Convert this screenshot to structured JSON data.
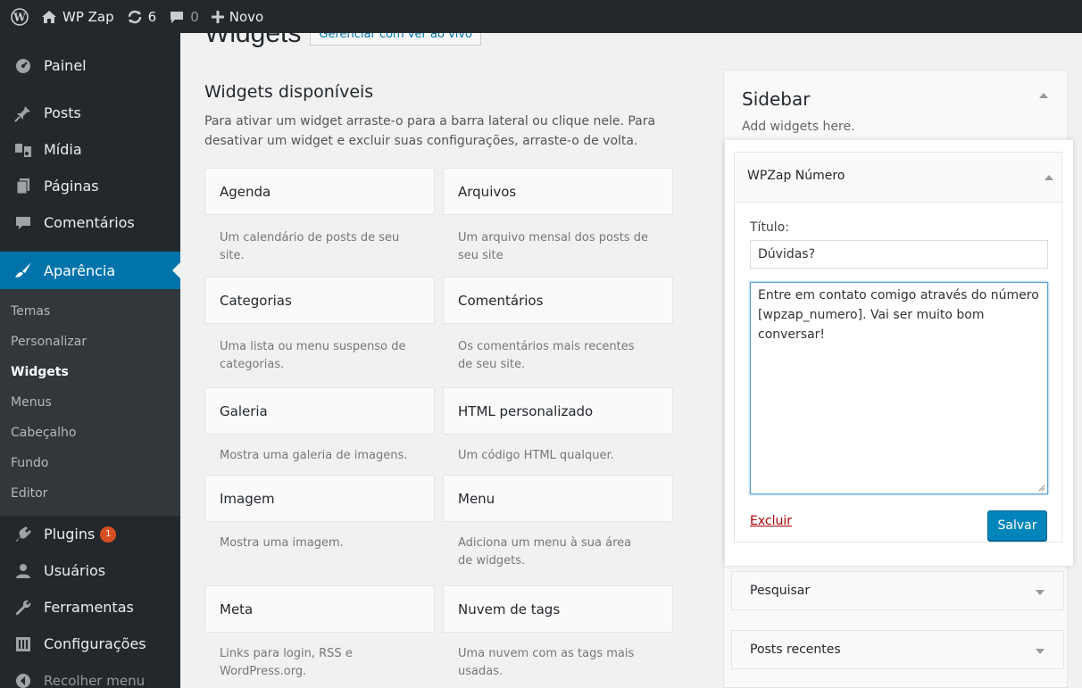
{
  "adminbar": {
    "site_name": "WP Zap",
    "updates_count": "6",
    "comments_count": "0",
    "new_label": "Novo"
  },
  "menu": {
    "items_top": [
      {
        "label": "Painel",
        "icon": "dashboard-icon"
      },
      {
        "label": "Posts",
        "icon": "pin-icon"
      },
      {
        "label": "Mídia",
        "icon": "media-icon"
      },
      {
        "label": "Páginas",
        "icon": "page-icon"
      },
      {
        "label": "Comentários",
        "icon": "comment-icon"
      }
    ],
    "active": {
      "label": "Aparência",
      "icon": "brush-icon"
    },
    "submenu": [
      "Temas",
      "Personalizar",
      "Widgets",
      "Menus",
      "Cabeçalho",
      "Fundo",
      "Editor"
    ],
    "submenu_current": "Widgets",
    "items_bottom": [
      {
        "label": "Plugins",
        "icon": "plugin-icon",
        "badge": "1"
      },
      {
        "label": "Usuários",
        "icon": "users-icon"
      },
      {
        "label": "Ferramentas",
        "icon": "wrench-icon"
      },
      {
        "label": "Configurações",
        "icon": "settings-icon"
      },
      {
        "label": "Recolher menu",
        "icon": "collapse-icon"
      }
    ]
  },
  "page": {
    "title": "Widgets",
    "action_label": "Gerenciar com ver ao vivo"
  },
  "available": {
    "title": "Widgets disponíveis",
    "description": "Para ativar um widget arraste-o para a barra lateral ou clique nele. Para desativar um widget e excluir suas configurações, arraste-o de volta.",
    "widgets": [
      {
        "name": "Agenda",
        "desc": "Um calendário de posts de seu site."
      },
      {
        "name": "Arquivos",
        "desc": "Um arquivo mensal dos posts de seu site"
      },
      {
        "name": "Categorias",
        "desc": "Uma lista ou menu suspenso de categorias."
      },
      {
        "name": "Comentários",
        "desc": "Os comentários mais recentes de seu site."
      },
      {
        "name": "Galeria",
        "desc": "Mostra uma galeria de imagens."
      },
      {
        "name": "HTML personalizado",
        "desc": "Um código HTML qualquer."
      },
      {
        "name": "Imagem",
        "desc": "Mostra uma imagem."
      },
      {
        "name": "Menu",
        "desc": "Adiciona um menu à sua área de widgets."
      },
      {
        "name": "Meta",
        "desc": "Links para login, RSS e WordPress.org."
      },
      {
        "name": "Nuvem de tags",
        "desc": "Uma nuvem com as tags mais usadas."
      }
    ]
  },
  "sidebar": {
    "title": "Sidebar",
    "description": "Add widgets here.",
    "open_widget": {
      "title": "WPZap Número",
      "field_label": "Título:",
      "title_value": "Dúvidas?",
      "content_value": "Entre em contato comigo através do número [wpzap_numero]. Vai ser muito bom conversar!",
      "delete_label": "Excluir",
      "save_label": "Salvar"
    },
    "collapsed_widgets": [
      "Pesquisar",
      "Posts recentes"
    ]
  },
  "colors": {
    "adminbar_bg": "#23282d",
    "active_menu": "#0073aa",
    "primary_button": "#0085ba",
    "plugin_badge": "#d54e21"
  }
}
